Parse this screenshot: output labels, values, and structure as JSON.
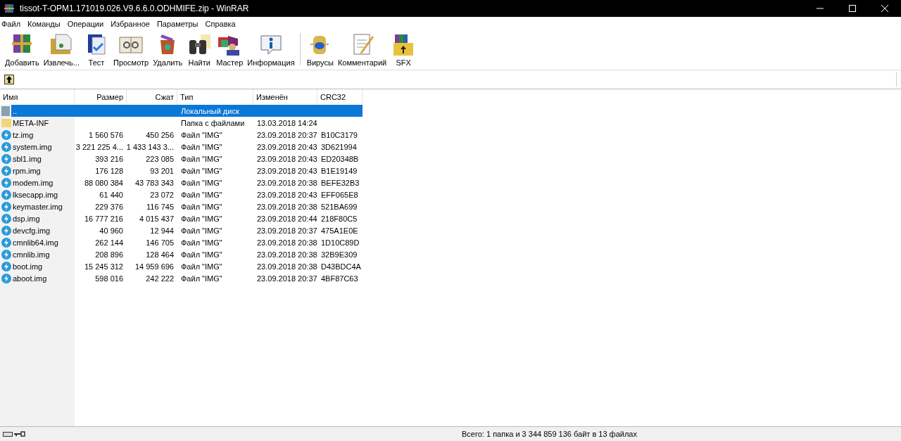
{
  "window": {
    "title": "tissot-T-OPM1.171019.026.V9.6.6.0.ODHMIFE.zip - WinRAR"
  },
  "menu": [
    "Файл",
    "Команды",
    "Операции",
    "Избранное",
    "Параметры",
    "Справка"
  ],
  "toolbar": [
    {
      "label": "Добавить",
      "kind": "add"
    },
    {
      "label": "Извлечь...",
      "kind": "extract"
    },
    {
      "label": "Тест",
      "kind": "test"
    },
    {
      "label": "Просмотр",
      "kind": "view"
    },
    {
      "label": "Удалить",
      "kind": "delete"
    },
    {
      "label": "Найти",
      "kind": "find"
    },
    {
      "label": "Мастер",
      "kind": "wizard"
    },
    {
      "label": "Информация",
      "kind": "info"
    },
    {
      "label": "Вирусы",
      "kind": "virus",
      "separator_before": true
    },
    {
      "label": "Комментарий",
      "kind": "comment"
    },
    {
      "label": "SFX",
      "kind": "sfx"
    }
  ],
  "table": {
    "columns": [
      {
        "label": "Имя"
      },
      {
        "label": "Размер"
      },
      {
        "label": "Сжат"
      },
      {
        "label": "Тип"
      },
      {
        "label": "Изменён"
      },
      {
        "label": "CRC32"
      }
    ],
    "rows": [
      {
        "kind": "parent",
        "name": "..",
        "size": "",
        "packed": "",
        "type": "Локальный диск",
        "modified": "",
        "crc": "",
        "selected": true
      },
      {
        "kind": "folder",
        "name": "META-INF",
        "size": "",
        "packed": "",
        "type": "Папка с файлами",
        "modified": "13.03.2018 14:24",
        "crc": "",
        "selected": false
      },
      {
        "kind": "file",
        "name": "tz.img",
        "size": "1 560 576",
        "packed": "450 256",
        "type": "Файл \"IMG\"",
        "modified": "23.09.2018 20:37",
        "crc": "B10C3179",
        "selected": false
      },
      {
        "kind": "file",
        "name": "system.img",
        "size": "3 221 225 4...",
        "packed": "1 433 143 3...",
        "type": "Файл \"IMG\"",
        "modified": "23.09.2018 20:43",
        "crc": "3D621994",
        "selected": false
      },
      {
        "kind": "file",
        "name": "sbl1.img",
        "size": "393 216",
        "packed": "223 085",
        "type": "Файл \"IMG\"",
        "modified": "23.09.2018 20:43",
        "crc": "ED20348B",
        "selected": false
      },
      {
        "kind": "file",
        "name": "rpm.img",
        "size": "176 128",
        "packed": "93 201",
        "type": "Файл \"IMG\"",
        "modified": "23.09.2018 20:43",
        "crc": "B1E19149",
        "selected": false
      },
      {
        "kind": "file",
        "name": "modem.img",
        "size": "88 080 384",
        "packed": "43 783 343",
        "type": "Файл \"IMG\"",
        "modified": "23.09.2018 20:38",
        "crc": "BEFE32B3",
        "selected": false
      },
      {
        "kind": "file",
        "name": "lksecapp.img",
        "size": "61 440",
        "packed": "23 072",
        "type": "Файл \"IMG\"",
        "modified": "23.09.2018 20:43",
        "crc": "EFF065E8",
        "selected": false
      },
      {
        "kind": "file",
        "name": "keymaster.img",
        "size": "229 376",
        "packed": "116 745",
        "type": "Файл \"IMG\"",
        "modified": "23.09.2018 20:38",
        "crc": "521BA699",
        "selected": false
      },
      {
        "kind": "file",
        "name": "dsp.img",
        "size": "16 777 216",
        "packed": "4 015 437",
        "type": "Файл \"IMG\"",
        "modified": "23.09.2018 20:44",
        "crc": "218F80C5",
        "selected": false
      },
      {
        "kind": "file",
        "name": "devcfg.img",
        "size": "40 960",
        "packed": "12 944",
        "type": "Файл \"IMG\"",
        "modified": "23.09.2018 20:37",
        "crc": "475A1E0E",
        "selected": false
      },
      {
        "kind": "file",
        "name": "cmnlib64.img",
        "size": "262 144",
        "packed": "146 705",
        "type": "Файл \"IMG\"",
        "modified": "23.09.2018 20:38",
        "crc": "1D10C89D",
        "selected": false
      },
      {
        "kind": "file",
        "name": "cmnlib.img",
        "size": "208 896",
        "packed": "128 464",
        "type": "Файл \"IMG\"",
        "modified": "23.09.2018 20:38",
        "crc": "32B9E309",
        "selected": false
      },
      {
        "kind": "file",
        "name": "boot.img",
        "size": "15 245 312",
        "packed": "14 959 696",
        "type": "Файл \"IMG\"",
        "modified": "23.09.2018 20:38",
        "crc": "D43BDC4A",
        "selected": false
      },
      {
        "kind": "file",
        "name": "aboot.img",
        "size": "598 016",
        "packed": "242 222",
        "type": "Файл \"IMG\"",
        "modified": "23.09.2018 20:37",
        "crc": "4BF87C63",
        "selected": false
      }
    ]
  },
  "status_bar": {
    "summary": "Всего: 1 папка и 3 344 859 136 байт в 13 файлах"
  }
}
